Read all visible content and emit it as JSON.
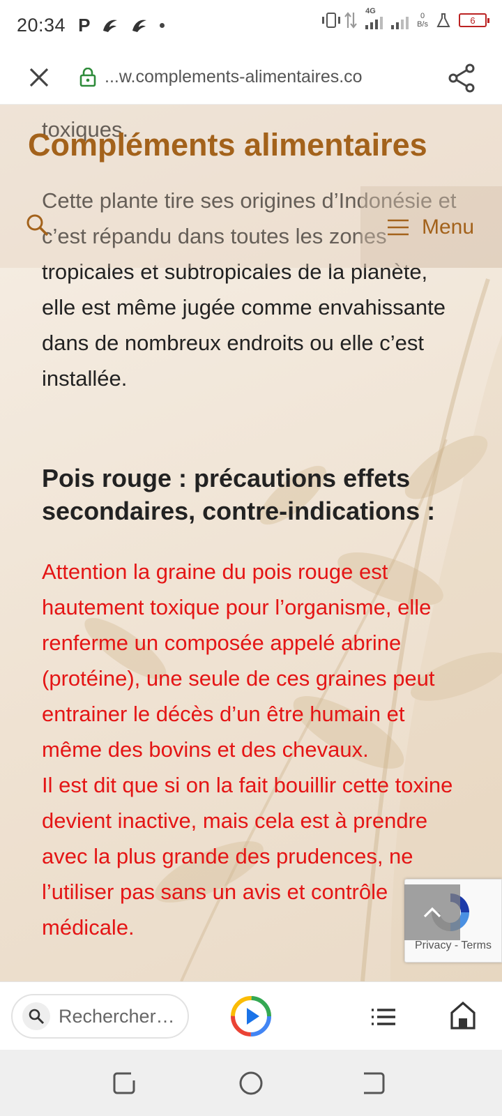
{
  "status_bar": {
    "time": "20:34",
    "network_type": "4G",
    "data_rate_value": "0",
    "data_rate_unit": "B/s",
    "battery_level": "6"
  },
  "browser": {
    "url": "...w.complements-alimentaires.co"
  },
  "site": {
    "title": "Compléments alimentaires",
    "menu_label": "Menu"
  },
  "article": {
    "partial_top_text": "toxiques.",
    "paragraph": "Cette plante tire ses origines d’Indonésie et c’est répandu dans toutes les zones tropicales et subtropicales de la planète, elle est même jugée comme envahissante dans de nombreux endroits ou elle c’est installée.",
    "heading": "Pois rouge : précautions effets secondaires, contre-indications :",
    "warning_1": "Attention la graine du pois rouge est hautement toxique pour l’organisme, elle renferme un composée appelé abrine (protéine), une seule de ces graines peut entrainer le décès d’un être humain et même des bovins et des chevaux.",
    "warning_2": "Il est dit que si on la fait bouillir cette toxine devient inactive, mais cela est à prendre avec la plus grande des prudences, ne l’utiliser pas sans un avis et contrôle médicale."
  },
  "recaptcha": {
    "privacy": "Privacy",
    "separator": " - ",
    "terms": "Terms"
  },
  "bottom_bar": {
    "search_placeholder": "Rechercher…"
  },
  "colors": {
    "brand": "#a3621b",
    "warning": "#e41515"
  }
}
